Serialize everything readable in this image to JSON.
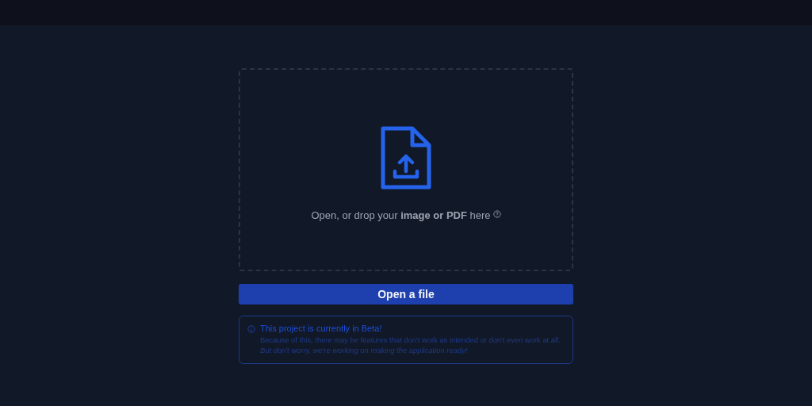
{
  "dropzone": {
    "prompt": "Open, or drop your **image or PDF** here"
  },
  "open_button": {
    "label": "Open a file"
  },
  "notice": {
    "title": "This project is currently in Beta!",
    "body": "Because of this, there may be features that don't work as intended or don't even work at all. *But don't worry, we're working on making the application ready!*"
  }
}
